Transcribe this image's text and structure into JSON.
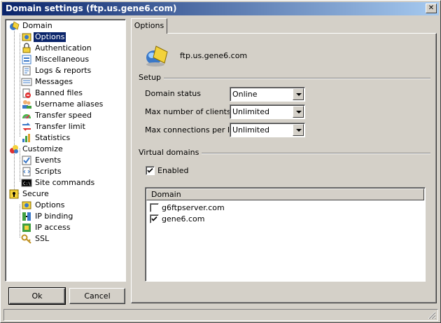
{
  "window": {
    "title": "Domain settings (ftp.us.gene6.com)"
  },
  "tree": {
    "items": [
      {
        "label": "Domain",
        "level": 0,
        "icon": "domain-icon"
      },
      {
        "label": "Options",
        "level": 1,
        "icon": "options-icon",
        "selected": true
      },
      {
        "label": "Authentication",
        "level": 1,
        "icon": "authentication-icon"
      },
      {
        "label": "Miscellaneous",
        "level": 1,
        "icon": "miscellaneous-icon"
      },
      {
        "label": "Logs & reports",
        "level": 1,
        "icon": "logs-icon"
      },
      {
        "label": "Messages",
        "level": 1,
        "icon": "messages-icon"
      },
      {
        "label": "Banned files",
        "level": 1,
        "icon": "banned-files-icon"
      },
      {
        "label": "Username aliases",
        "level": 1,
        "icon": "username-aliases-icon"
      },
      {
        "label": "Transfer speed",
        "level": 1,
        "icon": "transfer-speed-icon"
      },
      {
        "label": "Transfer limit",
        "level": 1,
        "icon": "transfer-limit-icon"
      },
      {
        "label": "Statistics",
        "level": 1,
        "icon": "statistics-icon"
      },
      {
        "label": "Customize",
        "level": 0,
        "icon": "customize-icon"
      },
      {
        "label": "Events",
        "level": 1,
        "icon": "events-icon"
      },
      {
        "label": "Scripts",
        "level": 1,
        "icon": "scripts-icon"
      },
      {
        "label": "Site commands",
        "level": 1,
        "icon": "site-commands-icon"
      },
      {
        "label": "Secure",
        "level": 0,
        "icon": "secure-icon"
      },
      {
        "label": "Options",
        "level": 1,
        "icon": "secure-options-icon"
      },
      {
        "label": "IP binding",
        "level": 1,
        "icon": "ip-binding-icon"
      },
      {
        "label": "IP access",
        "level": 1,
        "icon": "ip-access-icon"
      },
      {
        "label": "SSL",
        "level": 1,
        "icon": "ssl-icon"
      }
    ]
  },
  "buttons": {
    "ok": "Ok",
    "cancel": "Cancel"
  },
  "tab": {
    "label": "Options"
  },
  "panel": {
    "domain_name": "ftp.us.gene6.com",
    "setup": {
      "title": "Setup",
      "domain_status_label": "Domain status",
      "domain_status_value": "Online",
      "max_clients_label": "Max number of clients",
      "max_clients_value": "Unlimited",
      "max_conn_label": "Max connections per IP",
      "max_conn_value": "Unlimited"
    },
    "virtual": {
      "title": "Virtual domains",
      "enabled_label": "Enabled",
      "enabled": true,
      "column_header": "Domain",
      "domains": [
        {
          "name": "g6ftpserver.com",
          "checked": false
        },
        {
          "name": "gene6.com",
          "checked": true
        }
      ]
    }
  }
}
